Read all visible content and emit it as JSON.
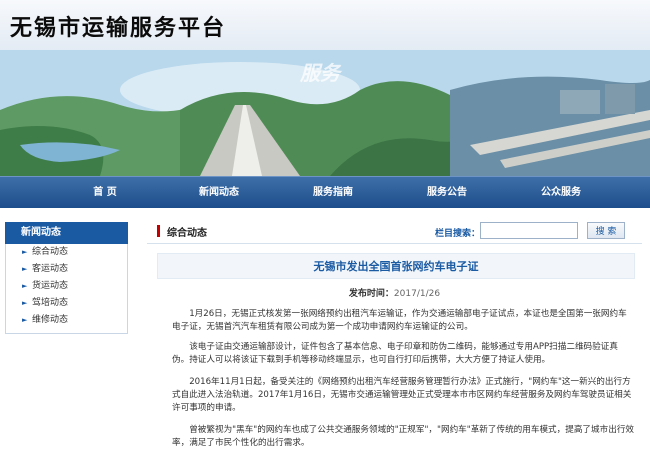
{
  "site": {
    "title": "无锡市运输服务平台"
  },
  "banner": {
    "watermark": "服务"
  },
  "nav": {
    "items": [
      "首 页",
      "新闻动态",
      "服务指南",
      "服务公告",
      "公众服务"
    ]
  },
  "sidebar": {
    "heading": "新闻动态",
    "items": [
      "综合动态",
      "客运动态",
      "货运动态",
      "驾培动态",
      "维修动态"
    ]
  },
  "main": {
    "section_title": "综合动态",
    "search": {
      "label": "栏目搜索：",
      "placeholder": "",
      "button": "搜 索"
    },
    "article": {
      "title": "无锡市发出全国首张网约车电子证",
      "date_label": "发布时间：",
      "date": "2017/1/26",
      "paragraphs": [
        "1月26日，无锡正式核发第一张网络预约出租汽车运输证，作为交通运输部电子证试点，本证也是全国第一张网约车电子证，无锡首汽汽车租赁有限公司成为第一个成功申请网约车运输证的公司。",
        "该电子证由交通运输部设计，证件包含了基本信息、电子印章和防伪二维码，能够通过专用APP扫描二维码验证真伪。持证人可以将该证下载到手机等移动终端显示，也可自行打印后携带，大大方便了持证人使用。",
        "2016年11月1日起，备受关注的《网络预约出租汽车经营服务管理暂行办法》正式施行，\"网约车\"这一新兴的出行方式自此进入法治轨道。2017年1月16日，无锡市交通运输管理处正式受理本市市区网约车经营服务及网约车驾驶员证相关许可事项的申请。",
        "曾被繁视为\"黑车\"的网约车也成了公共交通服务领域的\"正规军\"，\"网约车\"革新了传统的用车模式，提高了城市出行效率，满足了市民个性化的出行需求。"
      ]
    }
  }
}
